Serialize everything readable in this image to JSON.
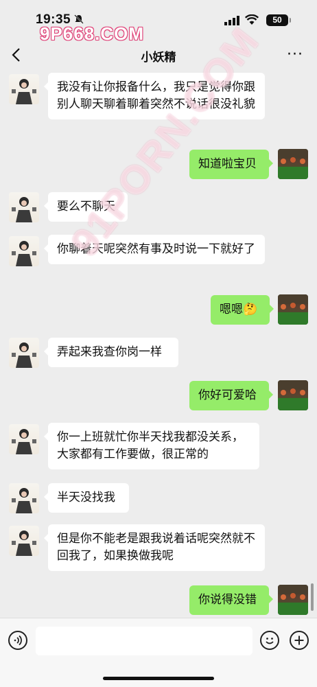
{
  "status": {
    "time": "19:35",
    "battery": "50"
  },
  "watermark": {
    "top": "9P668.COM",
    "diagonal": "91PORN.COM"
  },
  "nav": {
    "title": "小妖精",
    "more": "···"
  },
  "messages": [
    {
      "side": "left",
      "text": "我没有让你报备什么，我只是觉得你跟别人聊天聊着聊着突然不说话很没礼貌"
    },
    {
      "side": "right",
      "text": "知道啦宝贝"
    },
    {
      "side": "left",
      "text": "要么不聊天"
    },
    {
      "side": "left",
      "text": "你聊着天呢突然有事及时说一下就好了"
    },
    {
      "side": "right",
      "text": "嗯嗯🤔"
    },
    {
      "side": "left",
      "text": "弄起来我查你岗一样"
    },
    {
      "side": "right",
      "text": "你好可爱哈"
    },
    {
      "side": "left",
      "text": "你一上班就忙你半天找我都没关系，大家都有工作要做，很正常的"
    },
    {
      "side": "left",
      "text": "半天没找我"
    },
    {
      "side": "left",
      "text": "但是你不能老是跟我说着话呢突然就不回我了，如果换做我呢"
    },
    {
      "side": "right",
      "text": "你说得没错"
    }
  ],
  "icons": {
    "voice": "voice-icon",
    "emoji": "emoji-icon",
    "plus": "plus-icon",
    "back": "back-arrow-icon"
  }
}
